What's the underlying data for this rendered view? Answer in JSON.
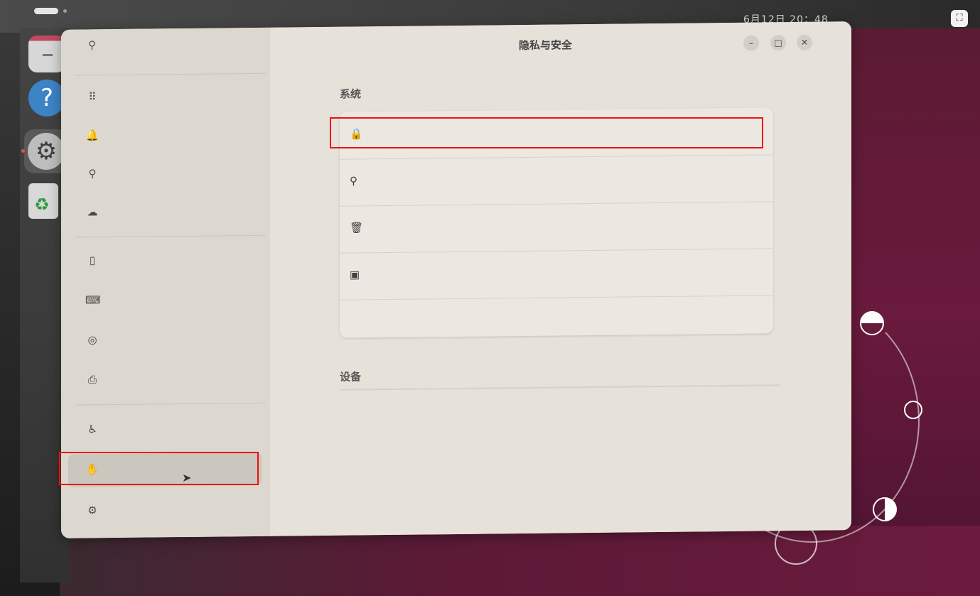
{
  "topbar": {
    "clock": "6月12日 20：48",
    "screenshot_icon": "screenshot-icon"
  },
  "dock": {
    "items": [
      {
        "name": "files-icon"
      },
      {
        "name": "help-icon",
        "glyph": "?"
      },
      {
        "name": "settings-icon"
      },
      {
        "name": "trash-icon",
        "glyph": "♻"
      }
    ]
  },
  "window": {
    "title": "隐私与安全",
    "buttons": {
      "minimize": "–",
      "maximize": "□",
      "close": "✕"
    }
  },
  "sidebar": {
    "search_glyph": "⚲",
    "items": [
      {
        "icon": "apps-icon",
        "glyph": "⠿"
      },
      {
        "icon": "bell-icon",
        "glyph": "🔔"
      },
      {
        "icon": "search-icon",
        "glyph": "⚲"
      },
      {
        "icon": "cloud-icon",
        "glyph": "☁"
      },
      {
        "icon": "mouse-icon",
        "glyph": "▯"
      },
      {
        "icon": "keyboard-icon",
        "glyph": "⌨"
      },
      {
        "icon": "color-icon",
        "glyph": "◎"
      },
      {
        "icon": "printer-icon",
        "glyph": "⎙"
      },
      {
        "icon": "accessibility-icon",
        "glyph": "♿"
      },
      {
        "icon": "hand-icon",
        "glyph": "✋"
      },
      {
        "icon": "gear-icon",
        "glyph": "⚙"
      }
    ]
  },
  "content": {
    "section_system": "系统",
    "section_devices": "设备",
    "rows": [
      {
        "icon": "lock-icon",
        "glyph": "🔒"
      },
      {
        "icon": "location-icon",
        "glyph": "⚲"
      },
      {
        "icon": "trash-file-icon",
        "glyph": "🗑"
      },
      {
        "icon": "camera-icon",
        "glyph": "▣"
      }
    ]
  }
}
